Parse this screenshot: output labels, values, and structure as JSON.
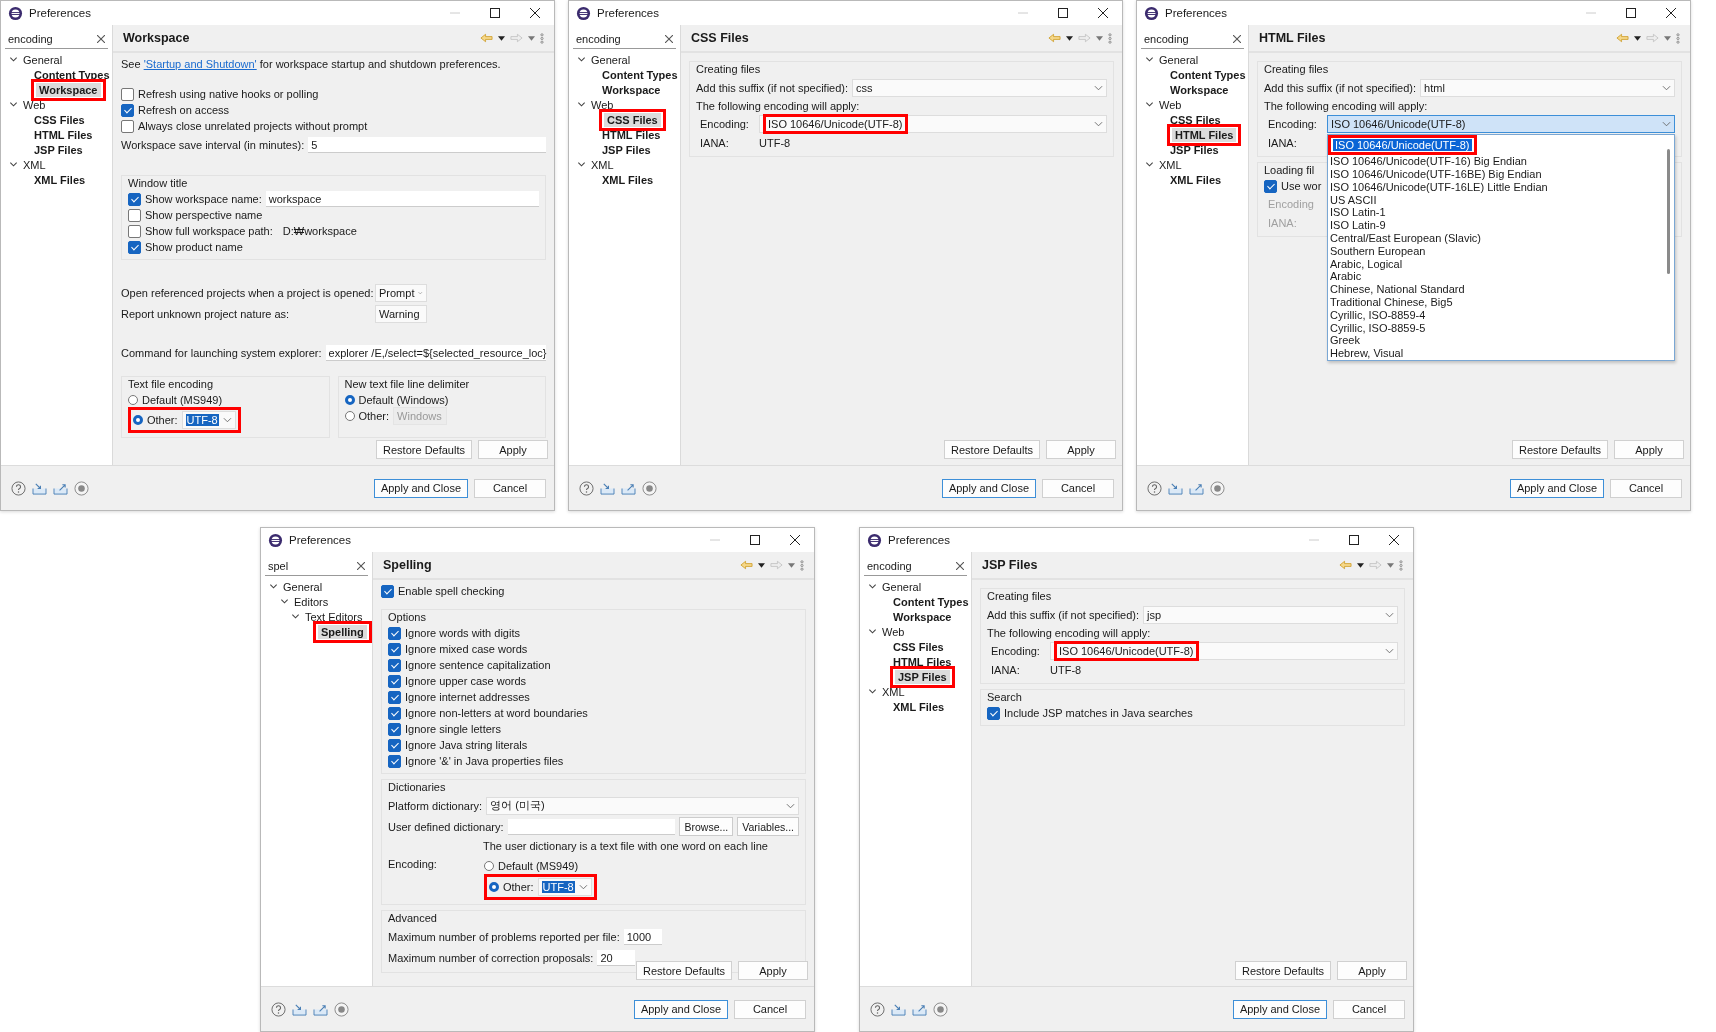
{
  "rows": [
    {
      "windows": [
        {
          "title": "Preferences",
          "filter": "encoding",
          "tree": [
            {
              "label": "General",
              "expanded": true,
              "matched": false,
              "selected": false,
              "highlighted": false,
              "children": [
                {
                  "label": "Content Types",
                  "matched": true,
                  "selected": false,
                  "highlighted": false
                },
                {
                  "label": "Workspace",
                  "matched": true,
                  "selected": true,
                  "highlighted": true
                }
              ]
            },
            {
              "label": "Web",
              "expanded": true,
              "matched": false,
              "selected": false,
              "highlighted": false,
              "children": [
                {
                  "label": "CSS Files",
                  "matched": true,
                  "selected": false,
                  "highlighted": false
                },
                {
                  "label": "HTML Files",
                  "matched": true,
                  "selected": false,
                  "highlighted": false
                },
                {
                  "label": "JSP Files",
                  "matched": true,
                  "selected": false,
                  "highlighted": false
                }
              ]
            },
            {
              "label": "XML",
              "expanded": true,
              "matched": false,
              "selected": false,
              "highlighted": false,
              "children": [
                {
                  "label": "XML Files",
                  "matched": true,
                  "selected": false,
                  "highlighted": false
                }
              ]
            }
          ],
          "page_title": "Workspace",
          "content": [
            {
              "kind": "link_text",
              "before": "See ",
              "link": "'Startup and Shutdown'",
              "after": " for workspace startup and shutdown preferences."
            },
            {
              "kind": "checkbox",
              "label": "Refresh using native hooks or polling",
              "checked": false
            },
            {
              "kind": "checkbox",
              "label": "Refresh on access",
              "checked": true
            },
            {
              "kind": "checkbox",
              "label": "Always close unrelated projects without prompt",
              "checked": false
            },
            {
              "kind": "field",
              "label": "Workspace save interval (in minutes):",
              "value": "5"
            },
            {
              "kind": "group",
              "title": "Window title",
              "items": [
                {
                  "kind": "checkbox",
                  "label": "Show workspace name:",
                  "checked": true,
                  "value": "workspace"
                },
                {
                  "kind": "checkbox",
                  "label": "Show perspective name",
                  "checked": false
                },
                {
                  "kind": "checkbox",
                  "label": "Show full workspace path:",
                  "checked": false,
                  "note": "D:₩workspace"
                },
                {
                  "kind": "checkbox",
                  "label": "Show product name",
                  "checked": true
                }
              ]
            },
            {
              "kind": "combo",
              "label": "Open referenced projects when a project is opened:",
              "value": "Prompt"
            },
            {
              "kind": "combo",
              "label": "Report unknown project nature as:",
              "value": "Warning"
            },
            {
              "kind": "field",
              "label": "Command for launching system explorer:",
              "value": "explorer /E,/select=${selected_resource_loc}"
            },
            {
              "kind": "columns",
              "groups": [
                {
                  "title": "Text file encoding",
                  "items": [
                    {
                      "kind": "radio",
                      "label": "Default (MS949)",
                      "selected": false,
                      "highlighted": false
                    },
                    {
                      "kind": "radio",
                      "label": "Other:",
                      "selected": true,
                      "highlighted": true,
                      "combo": {
                        "value": "UTF-8",
                        "text_selected": true,
                        "disabled": false
                      }
                    }
                  ]
                },
                {
                  "title": "New text file line delimiter",
                  "items": [
                    {
                      "kind": "radio",
                      "label": "Default (Windows)",
                      "selected": true,
                      "highlighted": false
                    },
                    {
                      "kind": "radio",
                      "label": "Other:",
                      "selected": false,
                      "highlighted": false,
                      "combo": {
                        "value": "Windows",
                        "text_selected": false,
                        "disabled": true
                      }
                    }
                  ]
                }
              ]
            }
          ],
          "page_buttons": [
            "Restore Defaults",
            "Apply"
          ],
          "dialog_buttons": [
            {
              "label": "Apply and Close",
              "default": true
            },
            {
              "label": "Cancel",
              "default": false
            }
          ]
        },
        {
          "title": "Preferences",
          "filter": "encoding",
          "tree": [
            {
              "label": "General",
              "expanded": true,
              "matched": false,
              "selected": false,
              "highlighted": false,
              "children": [
                {
                  "label": "Content Types",
                  "matched": true,
                  "selected": false,
                  "highlighted": false
                },
                {
                  "label": "Workspace",
                  "matched": true,
                  "selected": false,
                  "highlighted": false
                }
              ]
            },
            {
              "label": "Web",
              "expanded": true,
              "matched": false,
              "selected": false,
              "highlighted": false,
              "children": [
                {
                  "label": "CSS Files",
                  "matched": true,
                  "selected": true,
                  "highlighted": true
                },
                {
                  "label": "HTML Files",
                  "matched": true,
                  "selected": false,
                  "highlighted": false
                },
                {
                  "label": "JSP Files",
                  "matched": true,
                  "selected": false,
                  "highlighted": false
                }
              ]
            },
            {
              "label": "XML",
              "expanded": true,
              "matched": false,
              "selected": false,
              "highlighted": false,
              "children": [
                {
                  "label": "XML Files",
                  "matched": true,
                  "selected": false,
                  "highlighted": false
                }
              ]
            }
          ],
          "page_title": "CSS Files",
          "content": [
            {
              "kind": "group",
              "title": "Creating files",
              "items": [
                {
                  "kind": "combo",
                  "label": "Add this suffix (if not specified):",
                  "value": "css"
                },
                {
                  "kind": "text",
                  "text": "The following encoding will apply:"
                },
                {
                  "kind": "sub_combo",
                  "label": "Encoding:",
                  "value": "ISO 10646/Unicode(UTF-8)",
                  "highlighted": true,
                  "open": false
                },
                {
                  "kind": "sub_info",
                  "label": "IANA:",
                  "value": "UTF-8",
                  "disabled": false
                }
              ]
            }
          ],
          "page_buttons": [
            "Restore Defaults",
            "Apply"
          ],
          "dialog_buttons": [
            {
              "label": "Apply and Close",
              "default": true
            },
            {
              "label": "Cancel",
              "default": false
            }
          ]
        },
        {
          "title": "Preferences",
          "filter": "encoding",
          "tree": [
            {
              "label": "General",
              "expanded": true,
              "matched": false,
              "selected": false,
              "highlighted": false,
              "children": [
                {
                  "label": "Content Types",
                  "matched": true,
                  "selected": false,
                  "highlighted": false
                },
                {
                  "label": "Workspace",
                  "matched": true,
                  "selected": false,
                  "highlighted": false
                }
              ]
            },
            {
              "label": "Web",
              "expanded": true,
              "matched": false,
              "selected": false,
              "highlighted": false,
              "children": [
                {
                  "label": "CSS Files",
                  "matched": true,
                  "selected": false,
                  "highlighted": false
                },
                {
                  "label": "HTML Files",
                  "matched": true,
                  "selected": true,
                  "highlighted": true
                },
                {
                  "label": "JSP Files",
                  "matched": true,
                  "selected": false,
                  "highlighted": false
                }
              ]
            },
            {
              "label": "XML",
              "expanded": true,
              "matched": false,
              "selected": false,
              "highlighted": false,
              "children": [
                {
                  "label": "XML Files",
                  "matched": true,
                  "selected": false,
                  "highlighted": false
                }
              ]
            }
          ],
          "page_title": "HTML Files",
          "content": [
            {
              "kind": "group",
              "title": "Creating files",
              "items": [
                {
                  "kind": "combo",
                  "label": "Add this suffix (if not specified):",
                  "value": "html"
                },
                {
                  "kind": "text",
                  "text": "The following encoding will apply:"
                },
                {
                  "kind": "sub_combo",
                  "label": "Encoding:",
                  "value": "ISO 10646/Unicode(UTF-8)",
                  "highlighted": false,
                  "open": true,
                  "options": [
                    {
                      "label": "ISO 10646/Unicode(UTF-8)",
                      "selected": true,
                      "highlighted": true
                    },
                    {
                      "label": "ISO 10646/Unicode(UTF-16) Big Endian",
                      "selected": false,
                      "highlighted": false
                    },
                    {
                      "label": "ISO 10646/Unicode(UTF-16BE) Big Endian",
                      "selected": false,
                      "highlighted": false
                    },
                    {
                      "label": "ISO 10646/Unicode(UTF-16LE) Little Endian",
                      "selected": false,
                      "highlighted": false
                    },
                    {
                      "label": "US ASCII",
                      "selected": false,
                      "highlighted": false
                    },
                    {
                      "label": "ISO Latin-1",
                      "selected": false,
                      "highlighted": false
                    },
                    {
                      "label": "ISO Latin-9",
                      "selected": false,
                      "highlighted": false
                    },
                    {
                      "label": "Central/East European (Slavic)",
                      "selected": false,
                      "highlighted": false
                    },
                    {
                      "label": "Southern European",
                      "selected": false,
                      "highlighted": false
                    },
                    {
                      "label": "Arabic, Logical",
                      "selected": false,
                      "highlighted": false
                    },
                    {
                      "label": "Arabic",
                      "selected": false,
                      "highlighted": false
                    },
                    {
                      "label": "Chinese, National Standard",
                      "selected": false,
                      "highlighted": false
                    },
                    {
                      "label": "Traditional Chinese, Big5",
                      "selected": false,
                      "highlighted": false
                    },
                    {
                      "label": "Cyrillic, ISO-8859-4",
                      "selected": false,
                      "highlighted": false
                    },
                    {
                      "label": "Cyrillic, ISO-8859-5",
                      "selected": false,
                      "highlighted": false
                    },
                    {
                      "label": "Greek",
                      "selected": false,
                      "highlighted": false
                    },
                    {
                      "label": "Hebrew, Visual",
                      "selected": false,
                      "highlighted": false
                    }
                  ]
                },
                {
                  "kind": "sub_info",
                  "label": "IANA:",
                  "disabled": false
                }
              ]
            },
            {
              "kind": "group",
              "title": "Loading fil",
              "items": [
                {
                  "kind": "checkbox",
                  "label": "Use wor",
                  "checked": true
                },
                {
                  "kind": "sub_info",
                  "label": "Encoding",
                  "disabled": true
                },
                {
                  "kind": "sub_info",
                  "label": "IANA:",
                  "disabled": true
                }
              ]
            }
          ],
          "page_buttons": [
            "Restore Defaults",
            "Apply"
          ],
          "dialog_buttons": [
            {
              "label": "Apply and Close",
              "default": true
            },
            {
              "label": "Cancel",
              "default": false
            }
          ]
        }
      ]
    },
    {
      "windows": [
        {
          "title": "Preferences",
          "filter": "spel",
          "tree": [
            {
              "label": "General",
              "expanded": true,
              "matched": false,
              "selected": false,
              "highlighted": false,
              "children": [
                {
                  "label": "Editors",
                  "expanded": true,
                  "matched": false,
                  "selected": false,
                  "highlighted": false,
                  "children": [
                    {
                      "label": "Text Editors",
                      "expanded": true,
                      "matched": false,
                      "selected": false,
                      "highlighted": false,
                      "children": [
                        {
                          "label": "Spelling",
                          "matched": true,
                          "selected": true,
                          "highlighted": true
                        }
                      ]
                    }
                  ]
                }
              ]
            }
          ],
          "page_title": "Spelling",
          "content": [
            {
              "kind": "checkbox",
              "label": "Enable spell checking",
              "checked": true
            },
            {
              "kind": "group",
              "title": "Options",
              "items": [
                {
                  "kind": "checkbox",
                  "label": "Ignore words with digits",
                  "checked": true
                },
                {
                  "kind": "checkbox",
                  "label": "Ignore mixed case words",
                  "checked": true
                },
                {
                  "kind": "checkbox",
                  "label": "Ignore sentence capitalization",
                  "checked": true
                },
                {
                  "kind": "checkbox",
                  "label": "Ignore upper case words",
                  "checked": true
                },
                {
                  "kind": "checkbox",
                  "label": "Ignore internet addresses",
                  "checked": true
                },
                {
                  "kind": "checkbox",
                  "label": "Ignore non-letters at word boundaries",
                  "checked": true
                },
                {
                  "kind": "checkbox",
                  "label": "Ignore single letters",
                  "checked": true
                },
                {
                  "kind": "checkbox",
                  "label": "Ignore Java string literals",
                  "checked": true
                },
                {
                  "kind": "checkbox",
                  "label": "Ignore '&' in Java properties files",
                  "checked": true
                }
              ]
            },
            {
              "kind": "group",
              "title": "Dictionaries",
              "items": [
                {
                  "kind": "combo",
                  "label": "Platform dictionary:",
                  "value": "영어 (미국)"
                },
                {
                  "kind": "field",
                  "label": "User defined dictionary:",
                  "buttons": [
                    "Browse...",
                    "Variables..."
                  ]
                },
                {
                  "kind": "note",
                  "text": "The user dictionary is a text file with one word on each line"
                },
                {
                  "kind": "radio_set",
                  "label": "Encoding:",
                  "options": [
                    {
                      "label": "Default (MS949)",
                      "selected": false,
                      "highlighted": false
                    },
                    {
                      "label": "Other:",
                      "selected": true,
                      "highlighted": true,
                      "combo": {
                        "value": "UTF-8",
                        "text_selected": true,
                        "disabled": false
                      }
                    }
                  ]
                }
              ]
            },
            {
              "kind": "group",
              "title": "Advanced",
              "items": [
                {
                  "kind": "field",
                  "label": "Maximum number of problems reported per file:",
                  "value": "1000"
                },
                {
                  "kind": "field",
                  "label": "Maximum number of correction proposals:",
                  "value": "20"
                }
              ]
            }
          ],
          "page_buttons": [
            "Restore Defaults",
            "Apply"
          ],
          "dialog_buttons": [
            {
              "label": "Apply and Close",
              "default": true
            },
            {
              "label": "Cancel",
              "default": false
            }
          ]
        },
        {
          "title": "Preferences",
          "filter": "encoding",
          "tree": [
            {
              "label": "General",
              "expanded": true,
              "matched": false,
              "selected": false,
              "highlighted": false,
              "children": [
                {
                  "label": "Content Types",
                  "matched": true,
                  "selected": false,
                  "highlighted": false
                },
                {
                  "label": "Workspace",
                  "matched": true,
                  "selected": false,
                  "highlighted": false
                }
              ]
            },
            {
              "label": "Web",
              "expanded": true,
              "matched": false,
              "selected": false,
              "highlighted": false,
              "children": [
                {
                  "label": "CSS Files",
                  "matched": true,
                  "selected": false,
                  "highlighted": false
                },
                {
                  "label": "HTML Files",
                  "matched": true,
                  "selected": false,
                  "highlighted": false
                },
                {
                  "label": "JSP Files",
                  "matched": true,
                  "selected": true,
                  "highlighted": true
                }
              ]
            },
            {
              "label": "XML",
              "expanded": true,
              "matched": false,
              "selected": false,
              "highlighted": false,
              "children": [
                {
                  "label": "XML Files",
                  "matched": true,
                  "selected": false,
                  "highlighted": false
                }
              ]
            }
          ],
          "page_title": "JSP Files",
          "content": [
            {
              "kind": "group",
              "title": "Creating files",
              "items": [
                {
                  "kind": "combo",
                  "label": "Add this suffix (if not specified):",
                  "value": "jsp"
                },
                {
                  "kind": "text",
                  "text": "The following encoding will apply:"
                },
                {
                  "kind": "sub_combo",
                  "label": "Encoding:",
                  "value": "ISO 10646/Unicode(UTF-8)",
                  "highlighted": true,
                  "open": false
                },
                {
                  "kind": "sub_info",
                  "label": "IANA:",
                  "value": "UTF-8",
                  "disabled": false
                }
              ]
            },
            {
              "kind": "group",
              "title": "Search",
              "items": [
                {
                  "kind": "checkbox",
                  "label": "Include JSP matches in Java searches",
                  "checked": true
                }
              ]
            }
          ],
          "page_buttons": [
            "Restore Defaults",
            "Apply"
          ],
          "dialog_buttons": [
            {
              "label": "Apply and Close",
              "default": true
            },
            {
              "label": "Cancel",
              "default": false
            }
          ]
        }
      ]
    }
  ]
}
